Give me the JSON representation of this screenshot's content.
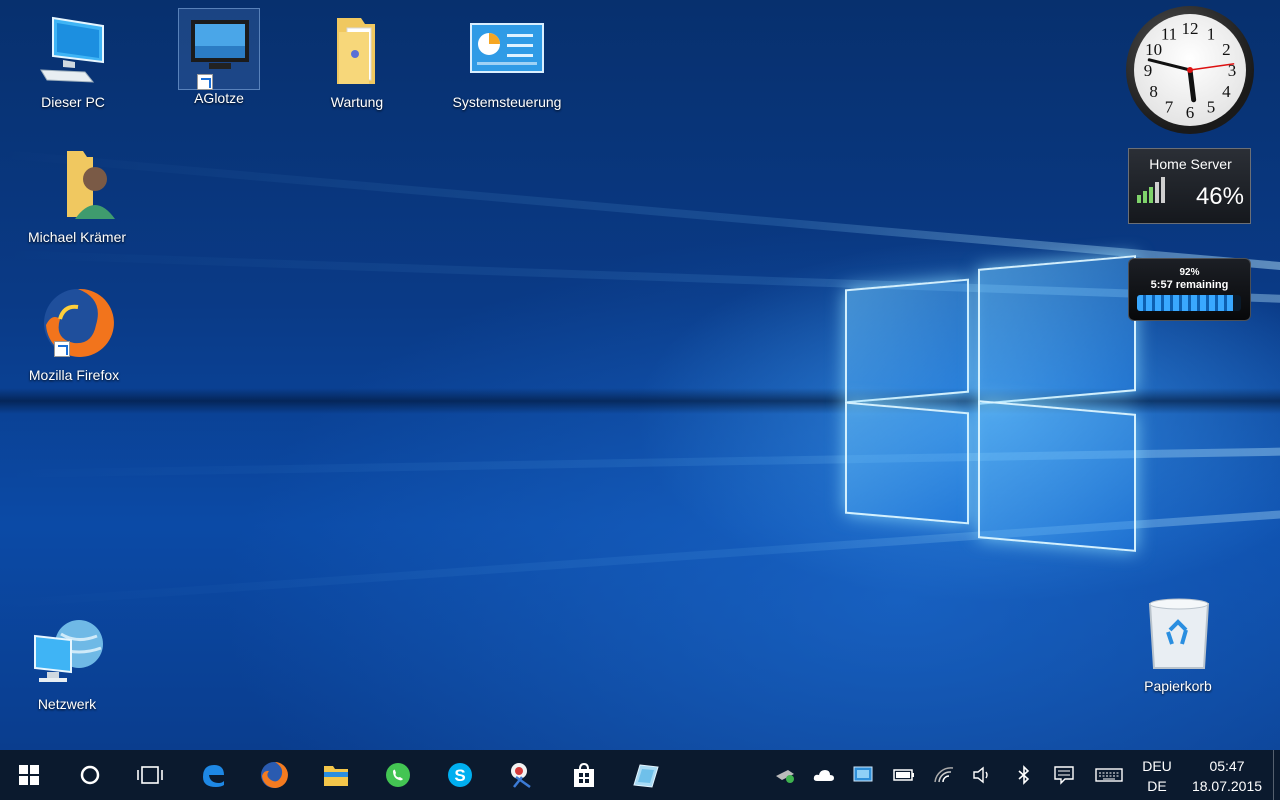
{
  "desktop": {
    "icons": [
      {
        "label": "Dieser PC"
      },
      {
        "label": "AGlotze"
      },
      {
        "label": "Wartung"
      },
      {
        "label": "Systemsteuerung"
      },
      {
        "label": "Michael Krämer"
      },
      {
        "label": "Mozilla Firefox"
      },
      {
        "label": "Netzwerk"
      },
      {
        "label": "Papierkorb"
      }
    ]
  },
  "gadgets": {
    "clock": {
      "numbers": [
        "12",
        "1",
        "2",
        "3",
        "4",
        "5",
        "6",
        "7",
        "8",
        "9",
        "10",
        "11"
      ]
    },
    "server": {
      "title": "Home Server",
      "value": "46%",
      "signal_fraction": 0.46
    },
    "battery": {
      "percent_label": "92%",
      "remaining_label": "5:57 remaining",
      "level": 0.92
    }
  },
  "taskbar": {
    "pinned": [
      {
        "name": "start-icon"
      },
      {
        "name": "cortana-icon"
      },
      {
        "name": "task-view-icon"
      },
      {
        "name": "edge-icon"
      },
      {
        "name": "firefox-icon"
      },
      {
        "name": "file-explorer-icon"
      },
      {
        "name": "whatsapp-icon"
      },
      {
        "name": "skype-icon"
      },
      {
        "name": "snipping-tool-icon"
      },
      {
        "name": "store-icon"
      },
      {
        "name": "app-icon"
      }
    ],
    "tray": [
      "network-share-icon",
      "onedrive-icon",
      "display-icon",
      "battery-icon",
      "wifi-icon",
      "volume-icon",
      "bluetooth-icon",
      "action-center-icon",
      "keyboard-icon"
    ],
    "lang_top": "DEU",
    "lang_bottom": "DE",
    "time": "05:47",
    "date": "18.07.2015"
  },
  "colors": {
    "accent": "#1a8cff",
    "taskbar": "#0b1a2e"
  }
}
